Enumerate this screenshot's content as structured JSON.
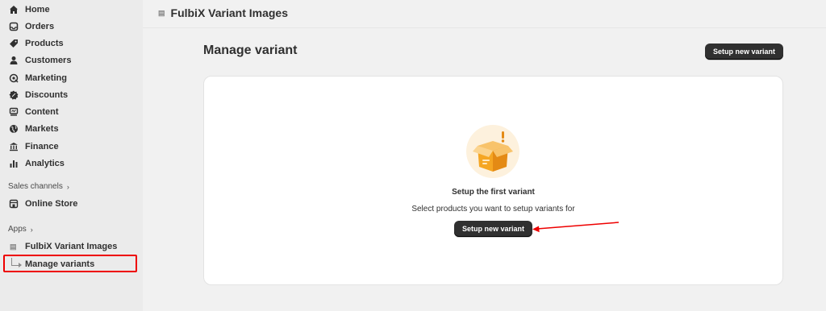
{
  "sidebar": {
    "items": [
      {
        "label": "Home",
        "icon": "home-icon"
      },
      {
        "label": "Orders",
        "icon": "inbox-icon"
      },
      {
        "label": "Products",
        "icon": "tag-icon"
      },
      {
        "label": "Customers",
        "icon": "person-icon"
      },
      {
        "label": "Marketing",
        "icon": "target-icon"
      },
      {
        "label": "Discounts",
        "icon": "discount-icon"
      },
      {
        "label": "Content",
        "icon": "content-icon"
      },
      {
        "label": "Markets",
        "icon": "globe-icon"
      },
      {
        "label": "Finance",
        "icon": "bank-icon"
      },
      {
        "label": "Analytics",
        "icon": "bar-chart-icon"
      }
    ],
    "sales_channels_label": "Sales channels",
    "online_store_label": "Online Store",
    "apps_label": "Apps",
    "app_name": "FulbiX Variant Images",
    "sub_item_label": "Manage variants"
  },
  "topbar": {
    "title": "FulbiX Variant Images"
  },
  "main": {
    "page_title": "Manage variant",
    "primary_button": "Setup new variant",
    "empty_state": {
      "heading": "Setup the first variant",
      "description": "Select products you want to setup variants for",
      "button": "Setup new variant"
    }
  },
  "colors": {
    "highlight": "#e00000",
    "button_dark": "#303030",
    "illustration_bg": "#fdf1dd",
    "illustration_box": "#f5a623"
  }
}
